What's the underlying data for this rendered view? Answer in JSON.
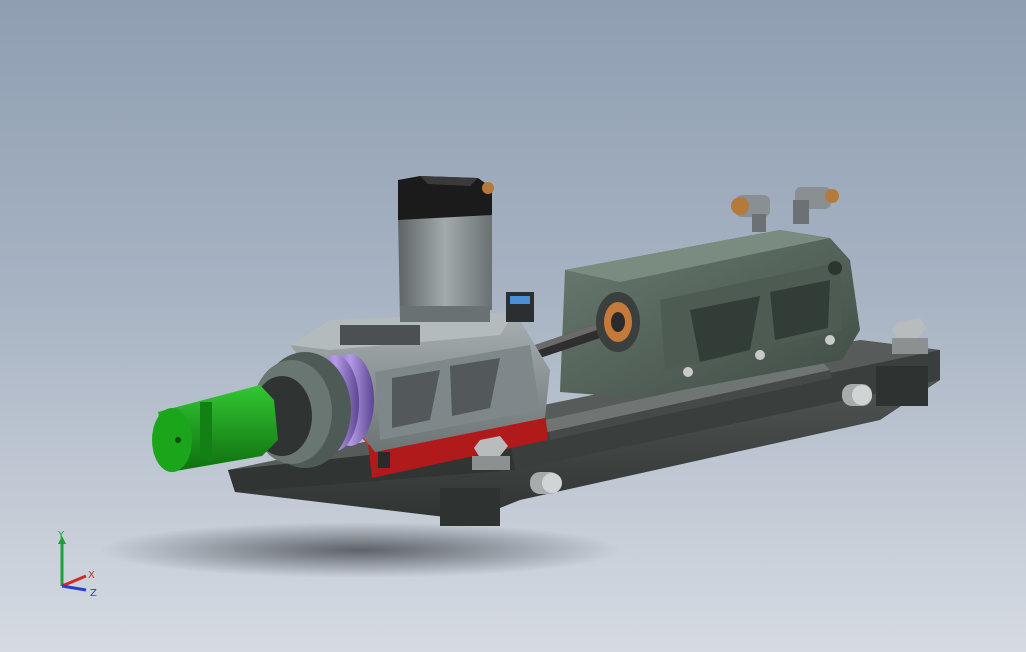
{
  "viewport": {
    "background_top": "#8f9eb2",
    "background_bottom": "#d6dbe2"
  },
  "model": {
    "colors": {
      "base_plate": "#474c4a",
      "frame": "#5b6c61",
      "housing": "#8d9698",
      "motor_body": "#7c8486",
      "motor_cap": "#1b1b1b",
      "chuck": "#1a9c1a",
      "ring": "#8d6fc7",
      "rail": "#c21d1d",
      "shaft": "#3e3e3e",
      "bearing": "#c47a3a"
    }
  },
  "triad": {
    "y_label": "Y",
    "x_label": "X",
    "z_label": "Z",
    "y_color": "#1aa33a",
    "x_color": "#d02a2a",
    "z_color": "#2a3fd0"
  }
}
